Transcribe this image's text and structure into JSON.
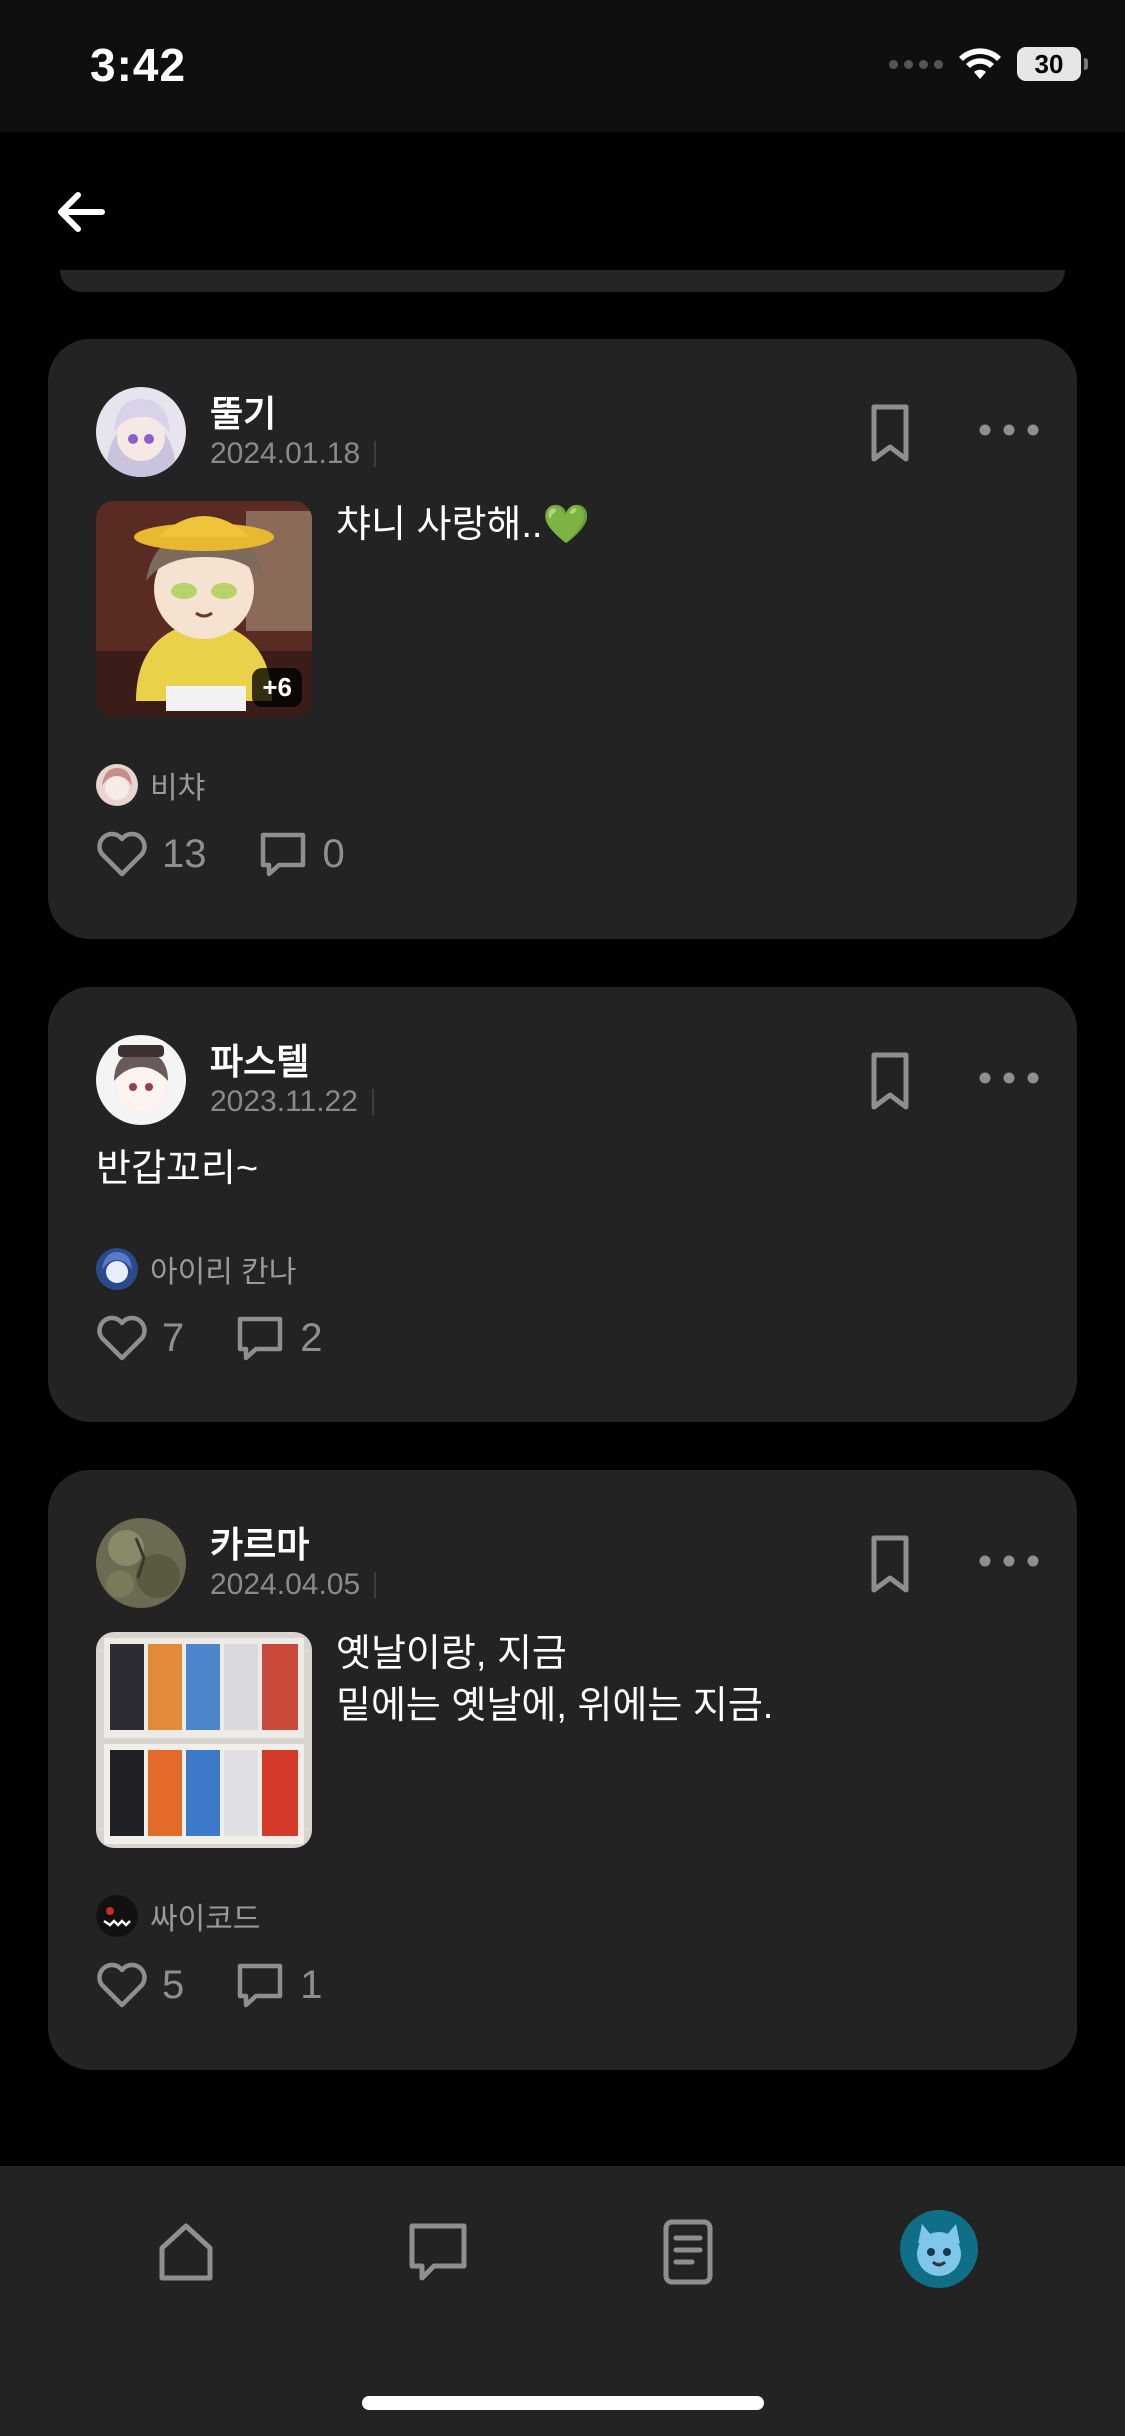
{
  "status": {
    "time": "3:42",
    "battery": "30"
  },
  "posts": [
    {
      "author": "뚤기",
      "date": "2024.01.18",
      "text_lines": [
        "챠니 사랑해..💚"
      ],
      "image_more": "+6",
      "channel": "비챠",
      "likes": "13",
      "comments": "0"
    },
    {
      "author": "파스텔",
      "date": "2023.11.22",
      "text_lines": [
        "반갑꼬리~"
      ],
      "channel": "아이리 칸나",
      "likes": "7",
      "comments": "2"
    },
    {
      "author": "카르마",
      "date": "2024.04.05",
      "text_lines": [
        "옛날이랑, 지금",
        "밑에는 옛날에, 위에는 지금."
      ],
      "channel": "싸이코드",
      "likes": "5",
      "comments": "1"
    }
  ],
  "icons": {
    "back": "arrow-left-icon",
    "bookmark": "bookmark-icon",
    "more": "more-horizontal-icon",
    "like": "heart-icon",
    "comment": "comment-icon",
    "tab_home": "home-icon",
    "tab_chat": "chat-icon",
    "tab_document": "document-icon",
    "tab_profile": "profile-avatar"
  },
  "colors": {
    "background": "#000000",
    "card": "#232323",
    "muted_text": "#8a8a8a",
    "profile_accent": "#0e6f86"
  }
}
